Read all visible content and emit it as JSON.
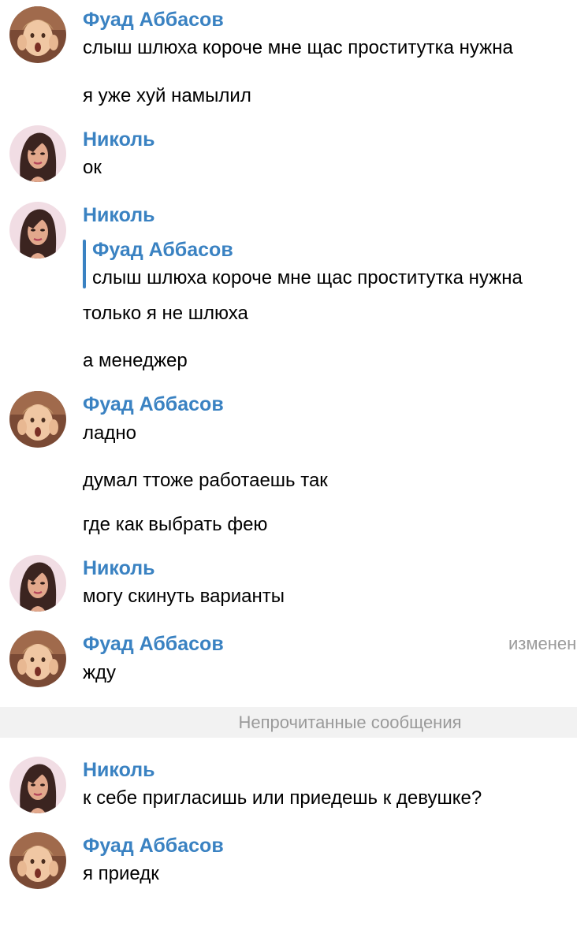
{
  "messages": {
    "m1": {
      "sender": "Фуад Аббасов",
      "lines": [
        "слыш шлюха короче мне щас проститутка нужна",
        "я уже хуй намылил"
      ]
    },
    "m2": {
      "sender": "Николь",
      "lines": [
        "ок"
      ]
    },
    "m3": {
      "sender": "Николь",
      "reply_to": {
        "sender": "Фуад Аббасов",
        "text": "слыш шлюха короче мне щас проститутка нужна"
      },
      "lines": [
        "только я не шлюха",
        "а менеджер"
      ]
    },
    "m4": {
      "sender": "Фуад Аббасов",
      "lines": [
        "ладно",
        "думал ттоже работаешь так",
        "где как выбрать фею"
      ]
    },
    "m5": {
      "sender": "Николь",
      "lines": [
        "могу скинуть варианты"
      ]
    },
    "m6": {
      "sender": "Фуад Аббасов",
      "edited_label": "изменено",
      "lines": [
        "жду"
      ]
    },
    "m7": {
      "sender": "Николь",
      "lines": [
        "к себе пригласишь или приедешь к девушке?"
      ]
    },
    "m8": {
      "sender": "Фуад Аббасов",
      "lines": [
        "я приедк"
      ]
    }
  },
  "unread_divider": "Непрочитанные сообщения",
  "colors": {
    "sender_name": "#3a82c2",
    "message_text": "#000000",
    "meta_text": "#9a9a9a",
    "divider_bg": "#f2f2f2"
  },
  "avatars": {
    "fuad": "boy-photo-avatar",
    "nikol": "illustrated-girl-avatar"
  }
}
